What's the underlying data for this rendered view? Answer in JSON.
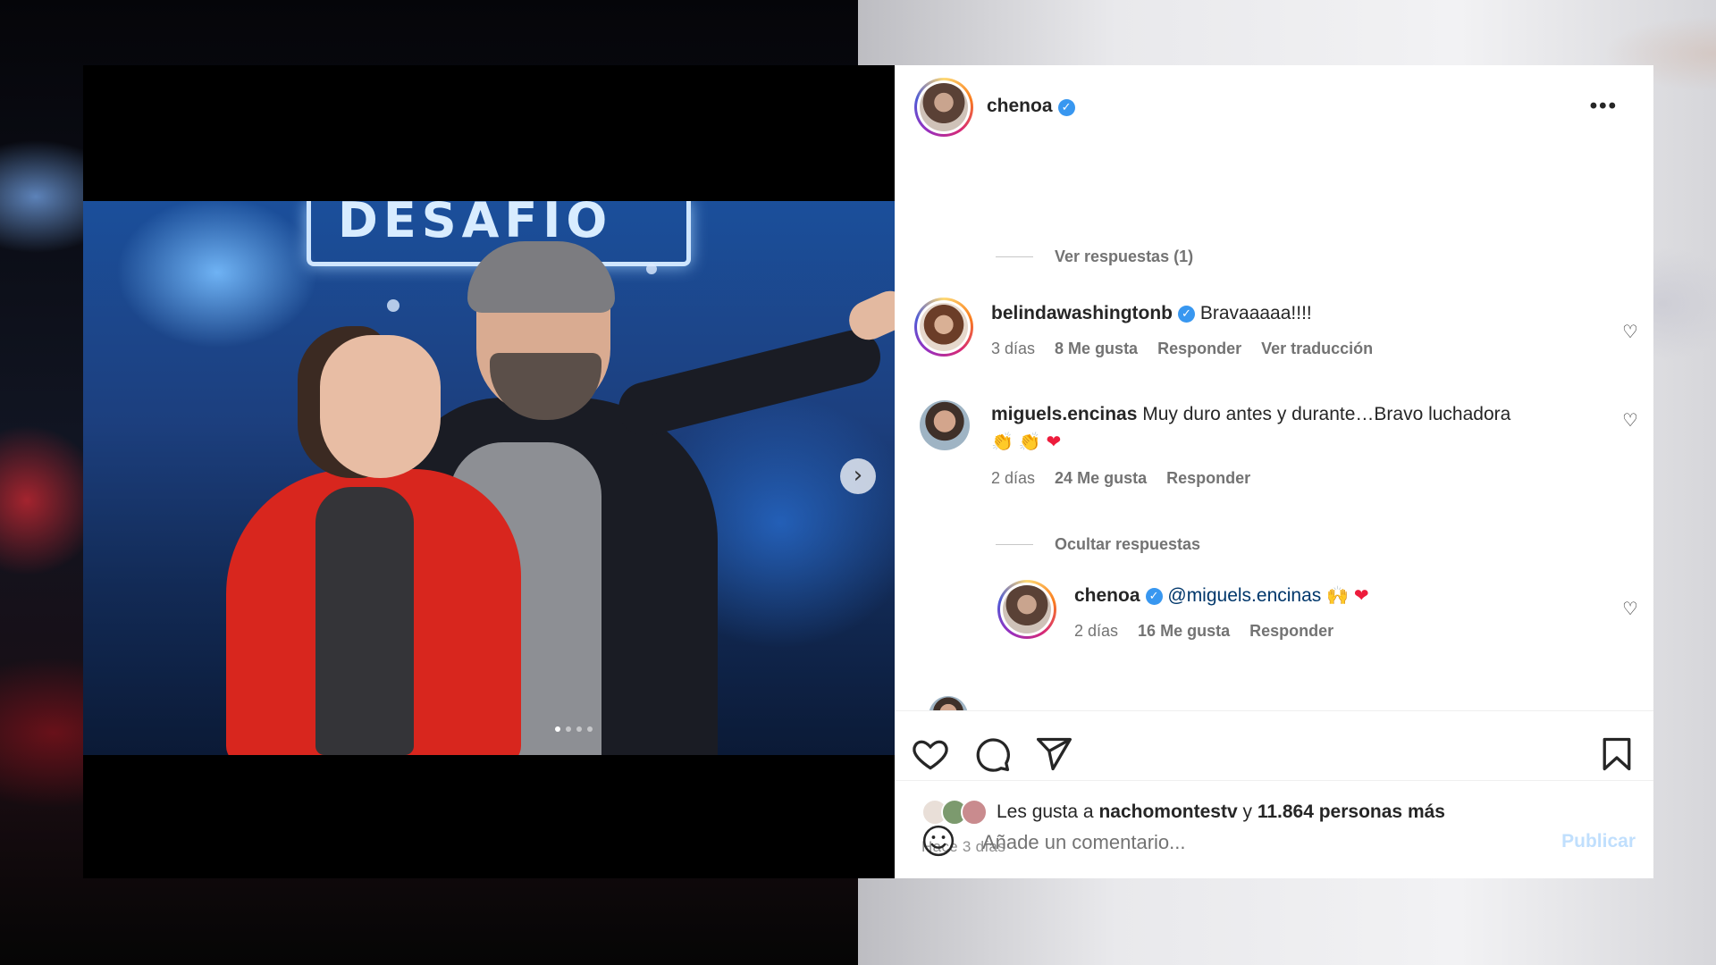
{
  "colors": {
    "accent": "#3897f0",
    "heart": "#ed1c3c",
    "muted": "#737373"
  },
  "media": {
    "sign_text": "DESAFÍO",
    "next_icon": "chevron-right-icon",
    "slide_count": 4
  },
  "header": {
    "username": "chenoa",
    "verified_icon": "verified-badge-icon",
    "more_icon": "ellipsis-icon"
  },
  "comments": {
    "view_replies_label": "Ver respuestas (1)",
    "items": [
      {
        "username": "belindawashingtonb",
        "verified": true,
        "text": "Bravaaaaa!!!!",
        "time": "3 días",
        "likes": "8 Me gusta",
        "reply": "Responder",
        "translate": "Ver traducción"
      },
      {
        "username": "miguels.encinas",
        "verified": false,
        "text": "Muy duro antes y durante…Bravo luchadora",
        "emojis": [
          "👏",
          "👏",
          "❤"
        ],
        "time": "2 días",
        "likes": "24 Me gusta",
        "reply": "Responder"
      }
    ],
    "hide_replies_label": "Ocultar respuestas",
    "reply": {
      "username": "chenoa",
      "verified": true,
      "mention": "@miguels.encinas",
      "emojis": [
        "🙌",
        "❤"
      ],
      "time": "2 días",
      "likes": "16 Me gusta",
      "reply": "Responder"
    }
  },
  "actions": {
    "like_icon": "heart-icon",
    "comment_icon": "comment-bubble-icon",
    "share_icon": "paper-plane-icon",
    "save_icon": "bookmark-icon"
  },
  "likes": {
    "prefix": "Les gusta a",
    "user": "nachomontestv",
    "connector": "y",
    "others": "11.864 personas más"
  },
  "time_ago": "Hace 3 días",
  "add_comment": {
    "emoji_icon": "smiley-icon",
    "placeholder": "Añade un comentario...",
    "publish_label": "Publicar"
  }
}
